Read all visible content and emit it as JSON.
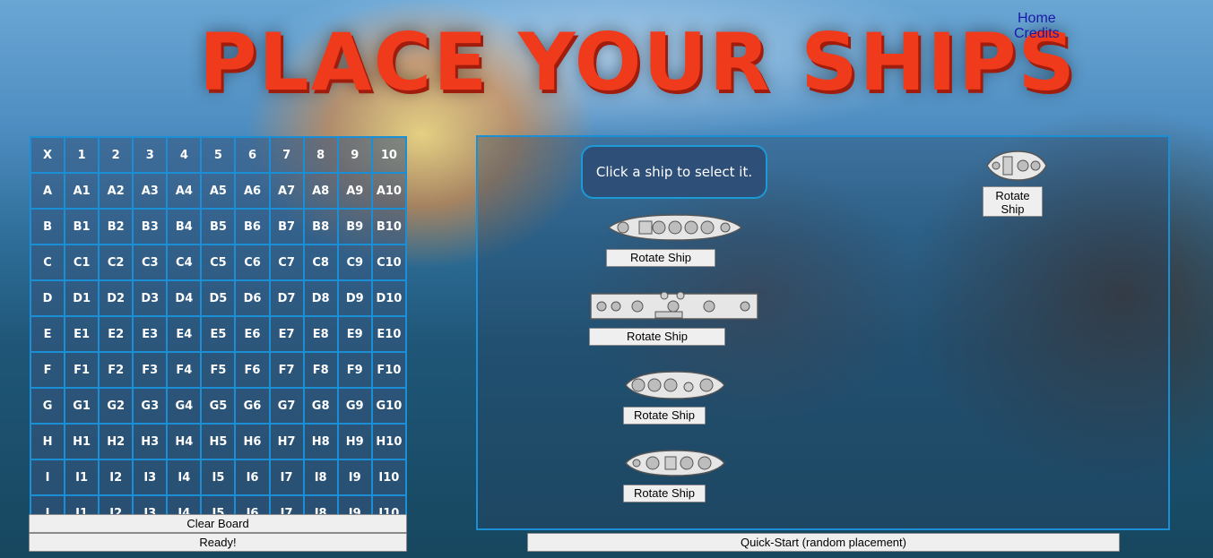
{
  "title": "PLACE YOUR SHIPS",
  "nav": {
    "home": "Home",
    "credits": "Credits"
  },
  "board": {
    "corner": "X",
    "columns": [
      "1",
      "2",
      "3",
      "4",
      "5",
      "6",
      "7",
      "8",
      "9",
      "10"
    ],
    "rows": [
      "A",
      "B",
      "C",
      "D",
      "E",
      "F",
      "G",
      "H",
      "I",
      "J"
    ]
  },
  "dock": {
    "tip": "Click a ship to select it.",
    "rotate_label": "Rotate Ship"
  },
  "buttons": {
    "clear": "Clear Board",
    "ready": "Ready!",
    "quick": "Quick-Start (random placement)"
  },
  "colors": {
    "title": "#f03a1c",
    "grid": "#1b8fd6",
    "tip_bg": "#2e4f78"
  }
}
